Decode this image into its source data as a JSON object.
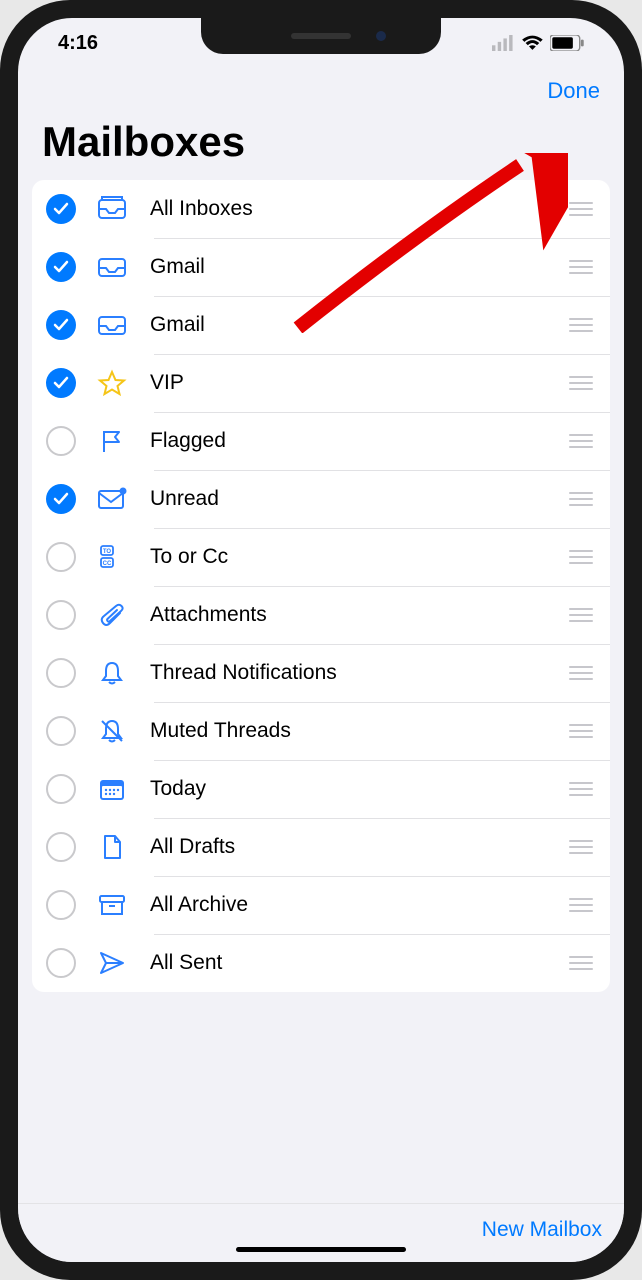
{
  "status": {
    "time": "4:16"
  },
  "nav": {
    "done": "Done"
  },
  "title": "Mailboxes",
  "rows": [
    {
      "label": "All Inboxes",
      "checked": true,
      "icon": "stacked-tray"
    },
    {
      "label": "Gmail",
      "checked": true,
      "icon": "tray"
    },
    {
      "label": "Gmail",
      "checked": true,
      "icon": "tray"
    },
    {
      "label": "VIP",
      "checked": true,
      "icon": "star"
    },
    {
      "label": "Flagged",
      "checked": false,
      "icon": "flag"
    },
    {
      "label": "Unread",
      "checked": true,
      "icon": "unread"
    },
    {
      "label": "To or Cc",
      "checked": false,
      "icon": "tocc"
    },
    {
      "label": "Attachments",
      "checked": false,
      "icon": "clip"
    },
    {
      "label": "Thread Notifications",
      "checked": false,
      "icon": "bell"
    },
    {
      "label": "Muted Threads",
      "checked": false,
      "icon": "bell-slash"
    },
    {
      "label": "Today",
      "checked": false,
      "icon": "calendar"
    },
    {
      "label": "All Drafts",
      "checked": false,
      "icon": "doc"
    },
    {
      "label": "All Archive",
      "checked": false,
      "icon": "archive"
    },
    {
      "label": "All Sent",
      "checked": false,
      "icon": "send"
    }
  ],
  "toolbar": {
    "new_mailbox": "New Mailbox"
  }
}
